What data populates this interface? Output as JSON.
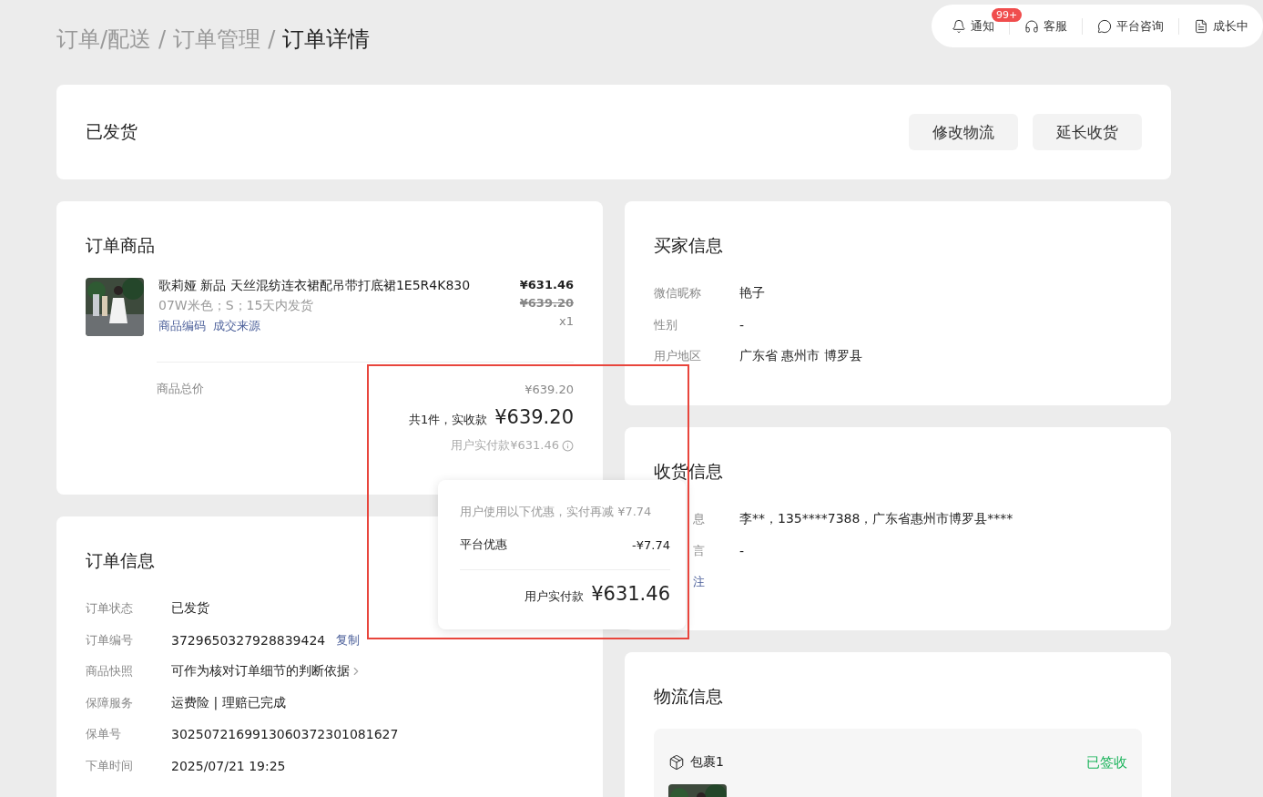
{
  "breadcrumb": [
    {
      "label": "订单/配送",
      "current": false
    },
    {
      "label": "订单管理",
      "current": false
    },
    {
      "label": "订单详情",
      "current": true
    }
  ],
  "breadcrumb_separator": "/",
  "toolbar": [
    {
      "kind": "bell",
      "label": "通知",
      "badge": "99+"
    },
    {
      "kind": "headset",
      "label": "客服"
    },
    {
      "kind": "chat",
      "label": "平台咨询"
    },
    {
      "kind": "doc",
      "label": "成长中"
    }
  ],
  "status": {
    "title": "已发货",
    "buttons": [
      "修改物流",
      "延长收货"
    ]
  },
  "goods": {
    "title": "订单商品",
    "product": {
      "name": "歌莉娅 新品 天丝混纺连衣裙配吊带打底裙1E5R4K830",
      "spec": "07W米色；S；15天内发货",
      "links": [
        "商品编码",
        "成交来源"
      ],
      "price": "¥631.46",
      "original_price": "¥639.20",
      "quantity": "x1"
    },
    "total_label": "商品总价",
    "total_value": "¥639.20",
    "received_label": "共1件，实收款",
    "received_value": "¥639.20",
    "paid_note": "用户实付款¥631.46"
  },
  "order_info": {
    "title": "订单信息",
    "rows": [
      {
        "label": "订单状态",
        "value": "已发货"
      },
      {
        "label": "订单编号",
        "value": "3729650327928839424",
        "action": "复制"
      },
      {
        "label": "商品快照",
        "value": "可作为核对订单细节的判断依据",
        "chevron": true
      },
      {
        "label": "保障服务",
        "value": "运费险 | 理赔已完成"
      },
      {
        "label": "保单号",
        "value": "3025072169913060372301081627"
      },
      {
        "label": "下单时间",
        "value": "2025/07/21 19:25"
      }
    ]
  },
  "buyer": {
    "title": "买家信息",
    "rows": [
      {
        "label": "微信昵称",
        "value": "艳子"
      },
      {
        "label": "性别",
        "value": "-"
      },
      {
        "label": "用户地区",
        "value": "广东省 惠州市 博罗县"
      }
    ]
  },
  "receiver": {
    "title": "收货信息",
    "rows": [
      {
        "label": "息",
        "value": "李**，135****7388，广东省惠州市博罗县****",
        "link": false
      },
      {
        "label": "言",
        "value": "-",
        "link": false
      },
      {
        "label": "注",
        "link": true
      }
    ]
  },
  "logistics": {
    "title": "物流信息",
    "package": {
      "name": "包裹1",
      "status": "已签收"
    }
  },
  "popover": {
    "note": "用户使用以下优惠，实付再减 ¥7.74",
    "rows": [
      {
        "label": "平台优惠",
        "value": "-¥7.74"
      }
    ],
    "total_label": "用户实付款",
    "total_value": "¥631.46"
  },
  "highlight": true
}
